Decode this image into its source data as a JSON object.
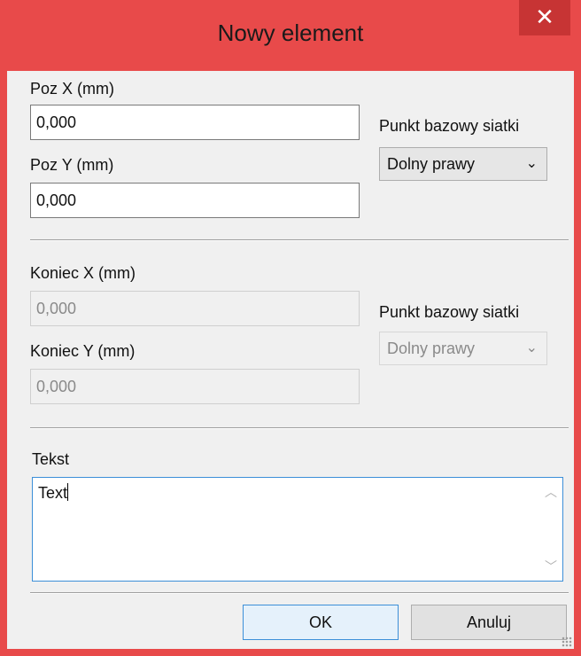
{
  "window": {
    "title": "Nowy element",
    "close_glyph": "✕",
    "accent_color": "#e84a4a"
  },
  "position": {
    "x_label": "Poz X (mm)",
    "x_value": "0,000",
    "y_label": "Poz Y (mm)",
    "y_value": "0,000",
    "base_label": "Punkt bazowy siatki",
    "base_value": "Dolny prawy"
  },
  "end": {
    "x_label": "Koniec X (mm)",
    "x_value": "0,000",
    "y_label": "Koniec Y (mm)",
    "y_value": "0,000",
    "base_label": "Punkt bazowy siatki",
    "base_value": "Dolny prawy"
  },
  "text": {
    "label": "Tekst",
    "value": "Text"
  },
  "buttons": {
    "ok": "OK",
    "cancel": "Anuluj"
  },
  "icons": {
    "close": "close-icon",
    "dropdown": "chevron-down-icon",
    "scroll_up": "scroll-up-icon",
    "scroll_down": "scroll-down-icon"
  }
}
